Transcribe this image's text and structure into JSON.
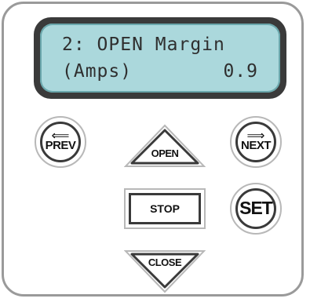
{
  "display": {
    "line1": "2: OPEN Margin",
    "line2_label": "(Amps)",
    "line2_value": "0.9"
  },
  "buttons": {
    "prev": "PREV",
    "next": "NEXT",
    "open": "OPEN",
    "stop": "STOP",
    "close": "CLOSE",
    "set": "SET"
  },
  "colors": {
    "lcd_background": "#abd8dc",
    "bezel": "#3a3a3a"
  }
}
